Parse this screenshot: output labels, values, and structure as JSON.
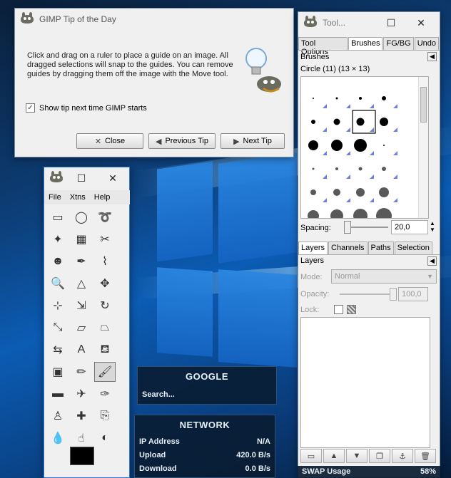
{
  "tip_dialog": {
    "title": "GIMP Tip of the Day",
    "text": "Click and drag on a ruler to place a guide on an image. All dragged selections will snap to the guides. You can remove guides by dragging them off the image with the Move tool.",
    "show_tip_label": "Show tip next time GIMP starts",
    "show_tip_checked": true,
    "close_label": "Close",
    "previous_label": "Previous Tip",
    "next_label": "Next Tip"
  },
  "toolbox": {
    "menu": [
      "File",
      "Xtns",
      "Help"
    ],
    "tools": [
      "rect-select-icon",
      "ellipse-select-icon",
      "lasso-icon",
      "magic-wand-icon",
      "select-by-color-icon",
      "scissors-icon",
      "foreground-select-icon",
      "paths-icon",
      "color-picker-icon",
      "zoom-icon",
      "measure-icon",
      "move-icon",
      "align-icon",
      "transform-icon",
      "rotate-icon",
      "scale-icon",
      "shear-icon",
      "perspective-icon",
      "flip-icon",
      "text-icon",
      "bucket-fill-icon",
      "blend-icon",
      "pencil-icon",
      "paintbrush-icon",
      "eraser-icon",
      "airbrush-icon",
      "ink-icon",
      "clone-icon",
      "heal-icon",
      "perspective-clone-icon",
      "blur-icon",
      "smudge-icon",
      "dodge-burn-icon"
    ],
    "active_tool_index": 23,
    "foreground_color": "#000000",
    "background_color": "#ffffff"
  },
  "dock": {
    "title": "Tool...",
    "tabs_top": [
      "Tool Options",
      "Brushes",
      "FG/BG",
      "Undo"
    ],
    "active_top": 1,
    "brushes_label": "Brushes",
    "brush_name": "Circle (11) (13 × 13)",
    "spacing_label": "Spacing:",
    "spacing_value": "20,0",
    "tabs_bottom": [
      "Layers",
      "Channels",
      "Paths",
      "Selection"
    ],
    "active_bottom": 0,
    "layers_label": "Layers",
    "mode_label": "Mode:",
    "mode_value": "Normal",
    "opacity_label": "Opacity:",
    "opacity_value": "100,0",
    "lock_label": "Lock:"
  },
  "widgets": {
    "google": {
      "title": "GOOGLE",
      "search_placeholder": "Search..."
    },
    "network": {
      "title": "NETWORK",
      "rows": [
        {
          "label": "IP Address",
          "value": "N/A"
        },
        {
          "label": "Upload",
          "value": "420.0 B/s"
        },
        {
          "label": "Download",
          "value": "0.0 B/s"
        }
      ]
    },
    "swap": {
      "label": "SWAP Usage",
      "value": "58%"
    }
  }
}
